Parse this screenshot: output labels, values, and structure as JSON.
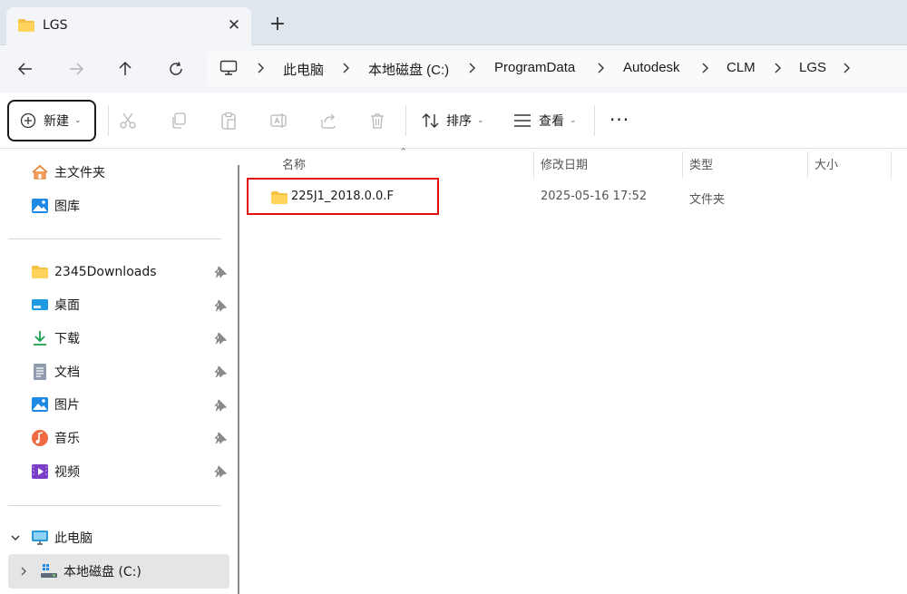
{
  "tab": {
    "title": "LGS",
    "close_glyph": "✕",
    "new_glyph": "+"
  },
  "nav": {
    "breadcrumb": [
      "此电脑",
      "本地磁盘 (C:)",
      "ProgramData",
      "Autodesk",
      "CLM",
      "LGS"
    ]
  },
  "toolbar": {
    "new_label": "新建",
    "sort_label": "排序",
    "view_label": "查看",
    "more_glyph": "···"
  },
  "sidebar": {
    "home": "主文件夹",
    "gallery": "图库",
    "pinned": [
      "2345Downloads",
      "桌面",
      "下载",
      "文档",
      "图片",
      "音乐",
      "视频"
    ],
    "this_pc": "此电脑",
    "local_disk": "本地磁盘 (C:)"
  },
  "columns": {
    "name": "名称",
    "modified": "修改日期",
    "type": "类型",
    "size": "大小"
  },
  "files": [
    {
      "name": "225J1_2018.0.0.F",
      "modified": "2025-05-16 17:52",
      "type": "文件夹",
      "size": ""
    }
  ],
  "colors": {
    "highlight": "#e20d0d",
    "folder": "#f5c242",
    "accent": "#0067c0"
  }
}
